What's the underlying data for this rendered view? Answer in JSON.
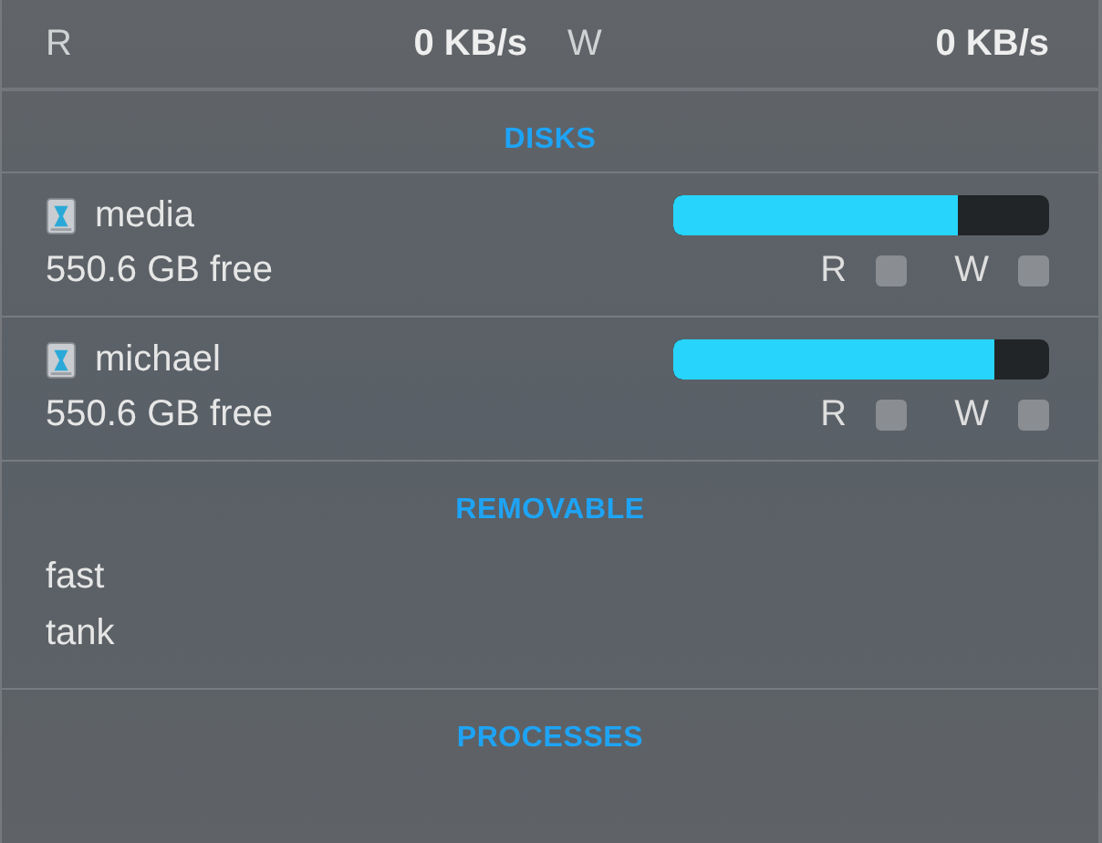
{
  "throughput": {
    "read_label": "R",
    "read_value": "0 KB/s",
    "write_label": "W",
    "write_value": "0 KB/s"
  },
  "sections": [
    {
      "kind": "disks",
      "title": "DISKS",
      "disks": [
        {
          "name": "media",
          "free": "550.6 GB free",
          "level": 0.757,
          "read_label": "R",
          "read_active": false,
          "write_label": "W",
          "write_active": false
        },
        {
          "name": "michael",
          "free": "550.6 GB free",
          "level": 0.854,
          "read_label": "R",
          "read_active": false,
          "write_label": "W",
          "write_active": false
        }
      ]
    },
    {
      "kind": "removable",
      "title": "REMOVABLE",
      "items": [
        "fast",
        "tank"
      ]
    },
    {
      "kind": "header",
      "title": "PROCESSES"
    }
  ]
}
